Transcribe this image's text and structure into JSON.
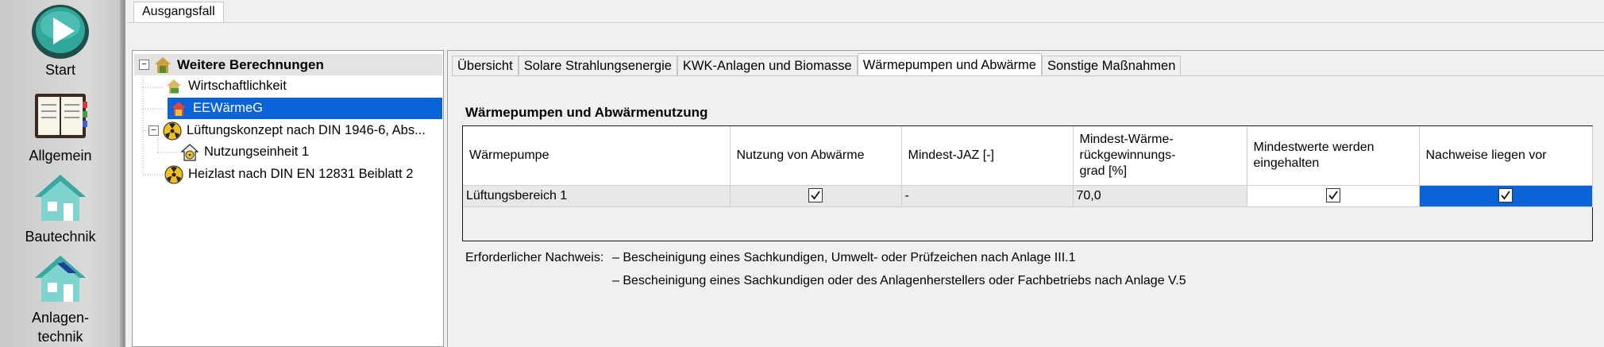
{
  "launcher": {
    "items": [
      {
        "label": "Start",
        "icon": "play-icon"
      },
      {
        "label": "Allgemein",
        "icon": "notebook-icon"
      },
      {
        "label": "Bautechnik",
        "icon": "house-icon"
      },
      {
        "label_line1": "Anlagen-",
        "label_line2": "technik",
        "icon": "house-solar-icon"
      }
    ]
  },
  "top_tab": {
    "label": "Ausgangsfall"
  },
  "tree": {
    "root": {
      "label": "Weitere Berechnungen",
      "expander": "−"
    },
    "items": [
      {
        "label": "Wirtschaftlichkeit"
      },
      {
        "label": "EEWärmeG"
      },
      {
        "label": "Lüftungskonzept nach DIN 1946-6, Abs...",
        "expander": "−"
      },
      {
        "label": "Nutzungseinheit 1"
      },
      {
        "label": "Heizlast nach DIN EN 12831 Beiblatt 2"
      }
    ]
  },
  "tabs": [
    {
      "label": "Übersicht"
    },
    {
      "label": "Solare Strahlungsenergie"
    },
    {
      "label": "KWK-Anlagen und Biomasse"
    },
    {
      "label": "Wärmepumpen und Abwärme"
    },
    {
      "label": "Sonstige Maßnahmen"
    }
  ],
  "section": {
    "title": "Wärmepumpen und Abwärmenutzung"
  },
  "table": {
    "headers": [
      "Wärmepumpe",
      "Nutzung von Abwärme",
      "Mindest-JAZ [-]",
      "Mindest-Wärme-rückgewinnungs-grad [%]",
      "Mindestwerte werden eingehalten",
      "Nachweise liegen vor"
    ],
    "header_lines": {
      "col3": [
        "Mindest-Wärme-",
        "rückgewinnungs-",
        "grad [%]"
      ],
      "col4": [
        "Mindestwerte werden",
        "eingehalten"
      ]
    },
    "rows": [
      {
        "waermepumpe": "Lüftungsbereich 1",
        "nutzung_abwaerme": true,
        "mindest_jaz": "-",
        "mindest_rueckgewinnung": "70,0",
        "mindestwerte_eingehalten": true,
        "nachweise_vorhanden": true
      }
    ]
  },
  "notes": {
    "label": "Erforderlicher Nachweis:",
    "items": [
      "– Bescheinigung eines Sachkundigen, Umwelt- oder Prüfzeichen nach Anlage III.1",
      "– Bescheinigung eines Sachkundigen oder des Anlagenherstellers oder Fachbetriebs nach Anlage V.5"
    ]
  },
  "colors": {
    "selection": "#0a64d8",
    "tree_root_bg": "#e3e3e3",
    "launcher_bg": "#d2d2d2"
  }
}
